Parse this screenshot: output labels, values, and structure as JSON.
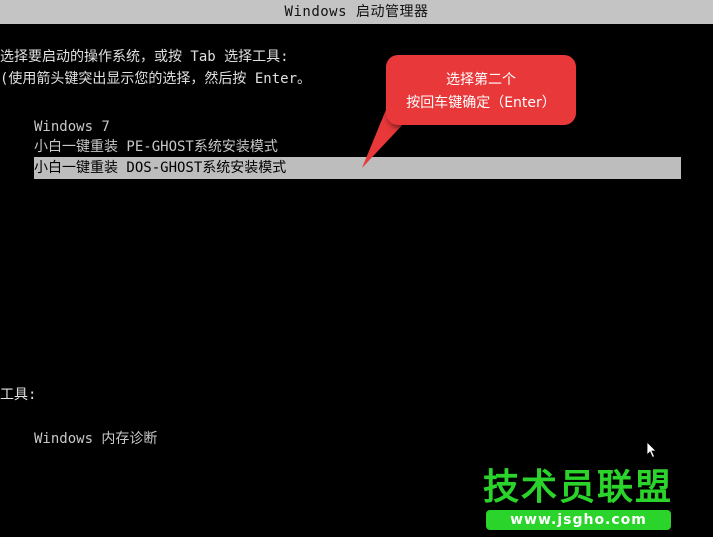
{
  "window": {
    "title": "Windows 启动管理器"
  },
  "prompt": {
    "line1": "选择要启动的操作系统，或按 Tab 选择工具:",
    "line2": "(使用箭头键突出显示您的选择，然后按 Enter。"
  },
  "menu": {
    "items": [
      {
        "label": "Windows 7"
      },
      {
        "label": "小白一键重装 PE-GHOST系统安装模式"
      },
      {
        "label": "小白一键重装 DOS-GHOST系统安装模式"
      }
    ],
    "selected_index": 2
  },
  "tools": {
    "label": "工具:",
    "items": [
      {
        "label": "Windows 内存诊断"
      }
    ]
  },
  "callout": {
    "line1": "选择第二个",
    "line2": "按回车键确定（Enter）",
    "color": "#e8383a"
  },
  "watermark": {
    "title": "技术员联盟",
    "url": "www.jsgho.com",
    "color": "#2bd42b"
  }
}
